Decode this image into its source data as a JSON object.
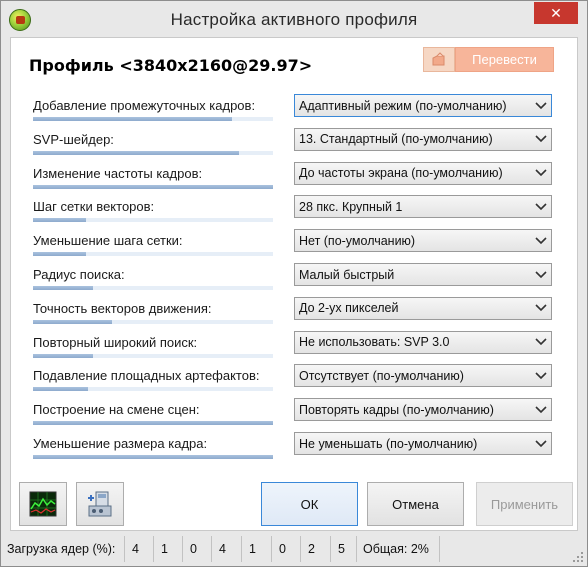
{
  "window": {
    "title": "Настройка активного профиля",
    "close_glyph": "✕"
  },
  "profile": {
    "title": "Профиль <3840x2160@29.97>"
  },
  "translate": {
    "label": "Перевести",
    "icon": "pencil-paper-icon"
  },
  "settings": [
    {
      "label": "Добавление промежуточных кадров:",
      "value": "Адаптивный режим (по-умолчанию)",
      "level": 0.83,
      "focused": true
    },
    {
      "label": "SVP-шейдер:",
      "value": "13. Стандартный (по-умолчанию)",
      "level": 0.86,
      "focused": false
    },
    {
      "label": "Изменение частоты кадров:",
      "value": "До частоты экрана (по-умолчанию)",
      "level": 1.0,
      "focused": false
    },
    {
      "label": "Шаг сетки векторов:",
      "value": "28 пкс. Крупный 1",
      "level": 0.22,
      "focused": false
    },
    {
      "label": "Уменьшение шага сетки:",
      "value": "Нет (по-умолчанию)",
      "level": 0.22,
      "focused": false
    },
    {
      "label": "Радиус поиска:",
      "value": "Малый быстрый",
      "level": 0.25,
      "focused": false
    },
    {
      "label": "Точность векторов движения:",
      "value": "До 2-ух пикселей",
      "level": 0.33,
      "focused": false
    },
    {
      "label": "Повторный широкий поиск:",
      "value": "Не использовать: SVP 3.0",
      "level": 0.25,
      "focused": false
    },
    {
      "label": "Подавление площадных артефактов:",
      "value": "Отсутствует (по-умолчанию)",
      "level": 0.23,
      "focused": false
    },
    {
      "label": "Построение на смене сцен:",
      "value": "Повторять кадры (по-умолчанию)",
      "level": 1.0,
      "focused": false
    },
    {
      "label": "Уменьшение размера кадра:",
      "value": "Не уменьшать (по-умолчанию)",
      "level": 1.0,
      "focused": false
    }
  ],
  "buttons": {
    "graph_icon": "cpu-graph-icon",
    "tools_icon": "settings-tools-icon",
    "ok": "ОК",
    "cancel": "Отмена",
    "apply": "Применить"
  },
  "status": {
    "load_label": "Загрузка ядер (%):",
    "cores": [
      "4",
      "1",
      "0",
      "4",
      "1",
      "0",
      "2",
      "5"
    ],
    "total": "Общая: 2%"
  },
  "colors": {
    "accent": "#3a88d8",
    "close": "#c7372e",
    "translate": "#f7b59a"
  }
}
